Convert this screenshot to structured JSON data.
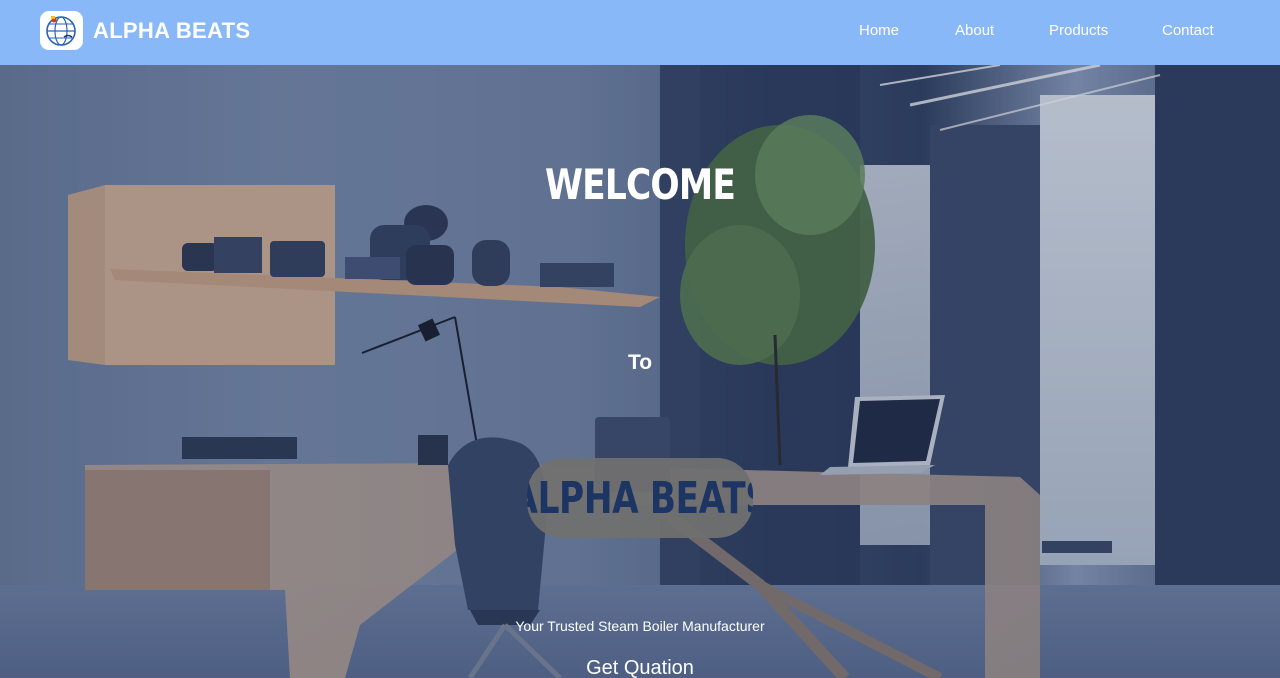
{
  "navbar": {
    "brand": "ALPHA BEATS",
    "logo_icon": "globe-logo-icon",
    "links": [
      {
        "label": "Home"
      },
      {
        "label": "About"
      },
      {
        "label": "Products"
      },
      {
        "label": "Contact"
      }
    ]
  },
  "hero": {
    "title": "WELCOME",
    "connector": "To",
    "badge": "ALPHA BEATS",
    "tagline": "Your Trusted Steam Boiler Manufacturer",
    "cta": "Get Quation",
    "background_image": "modern-office-interior-image"
  },
  "colors": {
    "navbar": "#88b8f8",
    "badge_bg": "#707070",
    "badge_text": "#1c3563",
    "text": "#ffffff"
  }
}
